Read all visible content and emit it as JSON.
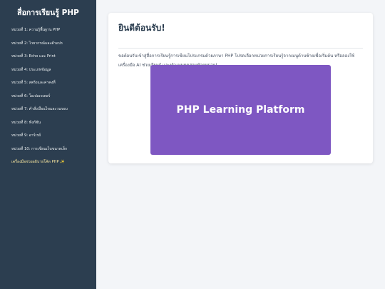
{
  "sidebar": {
    "title": "สื่อการเรียนรู้ PHP",
    "items": [
      {
        "label": "หน่วยที่ 1: ความรู้พื้นฐาน PHP"
      },
      {
        "label": "หน่วยที่ 2: ไวยากรณ์และตัวแปร"
      },
      {
        "label": "หน่วยที่ 3: Echo และ Print"
      },
      {
        "label": "หน่วยที่ 4: ประเภทข้อมูล"
      },
      {
        "label": "หน่วยที่ 5: สตริงและค่าคงที่"
      },
      {
        "label": "หน่วยที่ 6: โอเปอเรเตอร์"
      },
      {
        "label": "หน่วยที่ 7: คำสั่งเงื่อนไขและวนรอบ"
      },
      {
        "label": "หน่วยที่ 8: ฟังก์ชัน"
      },
      {
        "label": "หน่วยที่ 9: อาร์เรย์"
      },
      {
        "label": "หน่วยที่ 10: การเขียนเว็บขนาดเล็ก"
      },
      {
        "label": "เครื่องมือช่วยอธิบายโค้ด PHP ✨"
      }
    ]
  },
  "main": {
    "title": "ยินดีต้อนรับ!",
    "description": "ขอต้อนรับเข้าสู่สื่อการเรียนรู้การเขียนโปรแกรมด้วยภาษา PHP โปรดเลือกหน่วยการเรียนรู้จากเมนูด้านซ้ายเพื่อเริ่มต้น หรือลองใช้เครื่องมือ AI ช่วยเรียนรู้ และทำแบบทดสอบท้ายหน่วย!",
    "banner_text": "PHP Learning Platform"
  },
  "colors": {
    "sidebar_bg": "#2c3e50",
    "page_bg": "#f3f5f8",
    "banner_bg": "#7e57c2",
    "title_text": "#2c3e50"
  }
}
